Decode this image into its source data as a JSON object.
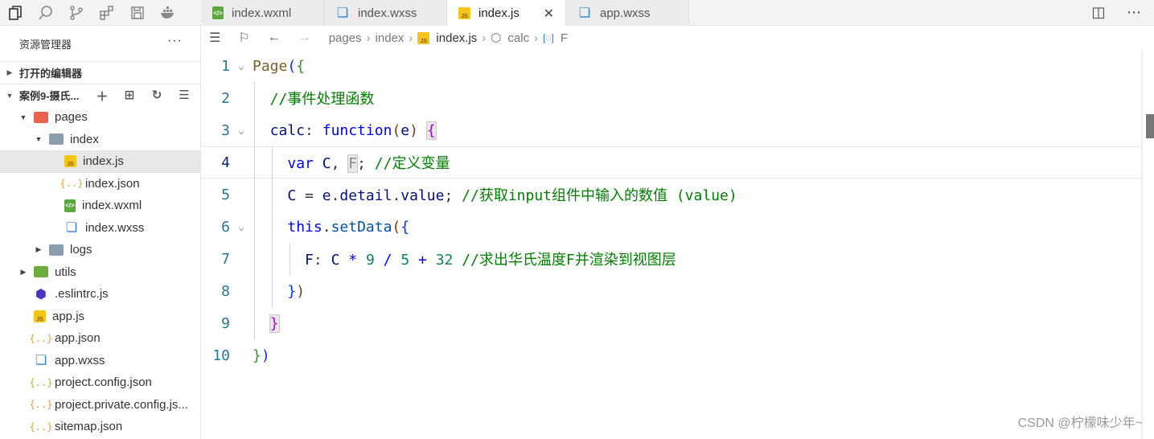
{
  "tabs": [
    {
      "label": "index.wxml",
      "icon": "wxml-icon",
      "active": false
    },
    {
      "label": "index.wxss",
      "icon": "wxss-icon",
      "active": false
    },
    {
      "label": "index.js",
      "icon": "js-icon",
      "active": true
    },
    {
      "label": "app.wxss",
      "icon": "wxss-icon",
      "active": false
    }
  ],
  "tab_close": "✕",
  "sidebar": {
    "title": "资源管理器",
    "more": "···",
    "open_editors": "打开的编辑器",
    "project": "案例9-摄氏...",
    "tree": [
      {
        "label": "pages",
        "indent": 1,
        "twisty": "▼",
        "icon": "folder-pages"
      },
      {
        "label": "index",
        "indent": 2,
        "twisty": "▼",
        "icon": "folder"
      },
      {
        "label": "index.js",
        "indent": 3,
        "twisty": "",
        "icon": "js",
        "selected": true
      },
      {
        "label": "index.json",
        "indent": 3,
        "twisty": "",
        "icon": "json"
      },
      {
        "label": "index.wxml",
        "indent": 3,
        "twisty": "",
        "icon": "wxml"
      },
      {
        "label": "index.wxss",
        "indent": 3,
        "twisty": "",
        "icon": "wxss"
      },
      {
        "label": "logs",
        "indent": 2,
        "twisty": "▶",
        "icon": "folder"
      },
      {
        "label": "utils",
        "indent": 1,
        "twisty": "▶",
        "icon": "folder-utils"
      },
      {
        "label": ".eslintrc.js",
        "indent": 1,
        "twisty": "",
        "icon": "eslint"
      },
      {
        "label": "app.js",
        "indent": 1,
        "twisty": "",
        "icon": "js"
      },
      {
        "label": "app.json",
        "indent": 1,
        "twisty": "",
        "icon": "json"
      },
      {
        "label": "app.wxss",
        "indent": 1,
        "twisty": "",
        "icon": "wxss"
      },
      {
        "label": "project.config.json",
        "indent": 1,
        "twisty": "",
        "icon": "json"
      },
      {
        "label": "project.private.config.js...",
        "indent": 1,
        "twisty": "",
        "icon": "json"
      },
      {
        "label": "sitemap.json",
        "indent": 1,
        "twisty": "",
        "icon": "json"
      }
    ]
  },
  "breadcrumb": {
    "items": [
      "pages",
      "index",
      "index.js",
      "calc",
      "F"
    ]
  },
  "editor": {
    "line_numbers": [
      "1",
      "2",
      "3",
      "4",
      "5",
      "6",
      "7",
      "8",
      "9",
      "10"
    ],
    "current_line": 4,
    "lines": [
      "Page({",
      "  //事件处理函数",
      "  calc: function(e) {",
      "    var C, F; //定义变量",
      "    C = e.detail.value; //获取input组件中输入的数值 (value)",
      "    this.setData({",
      "      F: C * 9 / 5 + 32 //求出华氏温度F并渲染到视图层",
      "    })",
      "  }",
      "})"
    ]
  },
  "watermark": "CSDN @柠檬味少年~"
}
